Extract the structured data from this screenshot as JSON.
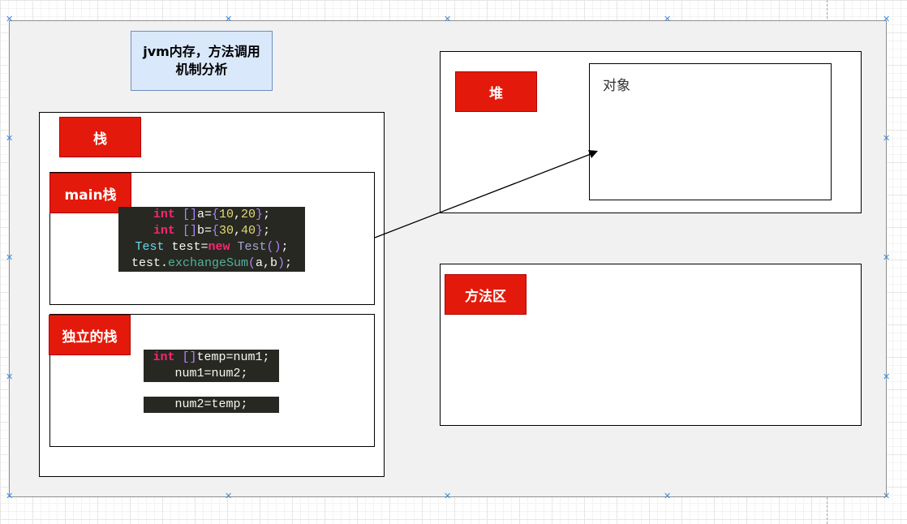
{
  "title": "jvm内存，方法调用\n机制分析",
  "stack": {
    "label": "栈"
  },
  "main_stack": {
    "label": "main栈",
    "code": {
      "line1": {
        "kw": "int",
        "bracket": "[]",
        "name": "a=",
        "open": "{",
        "n1": "10",
        "comma": ",",
        "n2": "20",
        "close": "}",
        "semi": ";"
      },
      "line2": {
        "kw": "int",
        "bracket": "[]",
        "name": "b=",
        "open": "{",
        "n1": "30",
        "comma": ",",
        "n2": "40",
        "close": "}",
        "semi": ";"
      },
      "line3": {
        "cls": "Test",
        "mid": " test=",
        "kw": "new",
        "sp": " ",
        "cls2": "Test",
        "paren": "()",
        "semi": ";"
      },
      "line4": {
        "obj": "test",
        "dot": ".",
        "fn": "exchangeSum",
        "open": "(",
        "args": "a,b",
        "close": ")",
        "semi": ";"
      }
    }
  },
  "independent_stack": {
    "label": "独立的栈",
    "code": {
      "line1": {
        "kw": "int",
        "sp": " ",
        "bracket": "[]",
        "rest": "temp=num1;"
      },
      "line2": "num1=num2;",
      "line3": "num2=temp;"
    }
  },
  "heap": {
    "label": "堆",
    "object_label": "对象"
  },
  "method_area": {
    "label": "方法区"
  }
}
